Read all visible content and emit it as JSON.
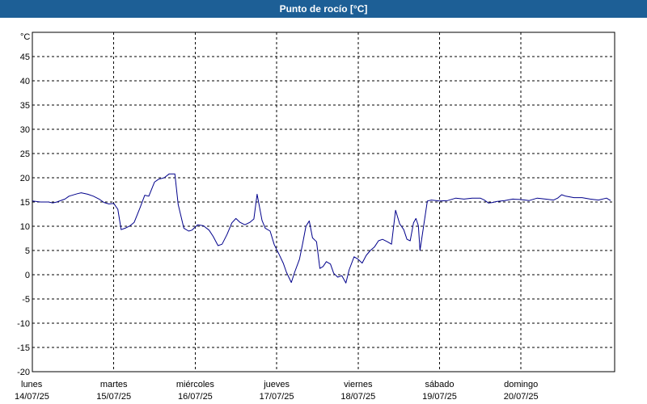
{
  "window": {
    "title": "Punto de rocío [°C]"
  },
  "chart_data": {
    "type": "line",
    "title": "Punto de rocío [°C]",
    "ylabel": "°C",
    "xlabel": "",
    "ylim": [
      -20,
      50
    ],
    "yticks": [
      -20,
      -15,
      -10,
      -5,
      0,
      5,
      10,
      15,
      20,
      25,
      30,
      35,
      40,
      45
    ],
    "y_unit_label": "°C",
    "grid": true,
    "x_start_date": "14/07/25",
    "x_range_days": [
      0,
      7.15
    ],
    "day_labels": [
      {
        "day": "lunes",
        "date": "14/07/25"
      },
      {
        "day": "martes",
        "date": "15/07/25"
      },
      {
        "day": "miércoles",
        "date": "16/07/25"
      },
      {
        "day": "jueves",
        "date": "17/07/25"
      },
      {
        "day": "viernes",
        "date": "18/07/25"
      },
      {
        "day": "sábado",
        "date": "19/07/25"
      },
      {
        "day": "domingo",
        "date": "20/07/25"
      }
    ],
    "series": [
      {
        "name": "",
        "color": "#00008b",
        "points": [
          [
            0.0,
            15.2
          ],
          [
            0.1,
            15.0
          ],
          [
            0.2,
            15.0
          ],
          [
            0.25,
            14.8
          ],
          [
            0.3,
            15.0
          ],
          [
            0.4,
            15.6
          ],
          [
            0.45,
            16.2
          ],
          [
            0.55,
            16.7
          ],
          [
            0.6,
            16.9
          ],
          [
            0.68,
            16.6
          ],
          [
            0.75,
            16.2
          ],
          [
            0.82,
            15.6
          ],
          [
            0.88,
            14.9
          ],
          [
            0.94,
            14.6
          ],
          [
            1.0,
            14.7
          ],
          [
            1.05,
            13.5
          ],
          [
            1.09,
            9.3
          ],
          [
            1.14,
            9.6
          ],
          [
            1.2,
            10.1
          ],
          [
            1.25,
            10.8
          ],
          [
            1.32,
            13.7
          ],
          [
            1.38,
            16.4
          ],
          [
            1.43,
            16.2
          ],
          [
            1.5,
            19.1
          ],
          [
            1.55,
            19.7
          ],
          [
            1.62,
            20.0
          ],
          [
            1.68,
            20.8
          ],
          [
            1.75,
            20.8
          ],
          [
            1.79,
            14.5
          ],
          [
            1.86,
            9.6
          ],
          [
            1.92,
            9.0
          ],
          [
            1.96,
            9.2
          ],
          [
            2.03,
            10.3
          ],
          [
            2.1,
            10.1
          ],
          [
            2.17,
            9.2
          ],
          [
            2.22,
            7.9
          ],
          [
            2.28,
            6.0
          ],
          [
            2.33,
            6.3
          ],
          [
            2.39,
            8.3
          ],
          [
            2.45,
            10.7
          ],
          [
            2.5,
            11.6
          ],
          [
            2.55,
            10.8
          ],
          [
            2.61,
            10.3
          ],
          [
            2.67,
            10.8
          ],
          [
            2.72,
            11.5
          ],
          [
            2.76,
            16.6
          ],
          [
            2.82,
            11.2
          ],
          [
            2.86,
            9.6
          ],
          [
            2.92,
            9.0
          ],
          [
            2.97,
            6.2
          ],
          [
            3.03,
            4.2
          ],
          [
            3.08,
            2.4
          ],
          [
            3.12,
            0.5
          ],
          [
            3.18,
            -1.6
          ],
          [
            3.22,
            0.5
          ],
          [
            3.28,
            3.2
          ],
          [
            3.32,
            6.5
          ],
          [
            3.36,
            10.0
          ],
          [
            3.4,
            11.1
          ],
          [
            3.44,
            7.6
          ],
          [
            3.49,
            6.8
          ],
          [
            3.53,
            1.3
          ],
          [
            3.57,
            1.7
          ],
          [
            3.61,
            2.7
          ],
          [
            3.66,
            2.2
          ],
          [
            3.7,
            0.3
          ],
          [
            3.75,
            -0.5
          ],
          [
            3.8,
            -0.2
          ],
          [
            3.85,
            -1.7
          ],
          [
            3.89,
            1.0
          ],
          [
            3.95,
            3.7
          ],
          [
            4.0,
            3.2
          ],
          [
            4.05,
            2.4
          ],
          [
            4.1,
            4.0
          ],
          [
            4.15,
            5.0
          ],
          [
            4.2,
            5.7
          ],
          [
            4.25,
            7.0
          ],
          [
            4.3,
            7.3
          ],
          [
            4.36,
            6.8
          ],
          [
            4.41,
            6.3
          ],
          [
            4.46,
            13.3
          ],
          [
            4.51,
            10.5
          ],
          [
            4.56,
            9.3
          ],
          [
            4.6,
            7.3
          ],
          [
            4.64,
            7.0
          ],
          [
            4.68,
            10.7
          ],
          [
            4.71,
            11.6
          ],
          [
            4.74,
            10.1
          ],
          [
            4.76,
            5.0
          ],
          [
            4.8,
            9.6
          ],
          [
            4.85,
            15.2
          ],
          [
            4.9,
            15.4
          ],
          [
            5.0,
            15.2
          ],
          [
            5.1,
            15.3
          ],
          [
            5.2,
            15.8
          ],
          [
            5.3,
            15.6
          ],
          [
            5.4,
            15.8
          ],
          [
            5.5,
            15.8
          ],
          [
            5.55,
            15.4
          ],
          [
            5.6,
            14.8
          ],
          [
            5.65,
            14.9
          ],
          [
            5.7,
            15.1
          ],
          [
            5.8,
            15.3
          ],
          [
            5.9,
            15.6
          ],
          [
            6.0,
            15.5
          ],
          [
            6.1,
            15.3
          ],
          [
            6.2,
            15.8
          ],
          [
            6.3,
            15.6
          ],
          [
            6.4,
            15.4
          ],
          [
            6.45,
            15.8
          ],
          [
            6.5,
            16.5
          ],
          [
            6.55,
            16.2
          ],
          [
            6.65,
            15.9
          ],
          [
            6.75,
            15.9
          ],
          [
            6.85,
            15.6
          ],
          [
            6.95,
            15.4
          ],
          [
            7.05,
            15.8
          ],
          [
            7.1,
            15.3
          ]
        ]
      }
    ]
  }
}
